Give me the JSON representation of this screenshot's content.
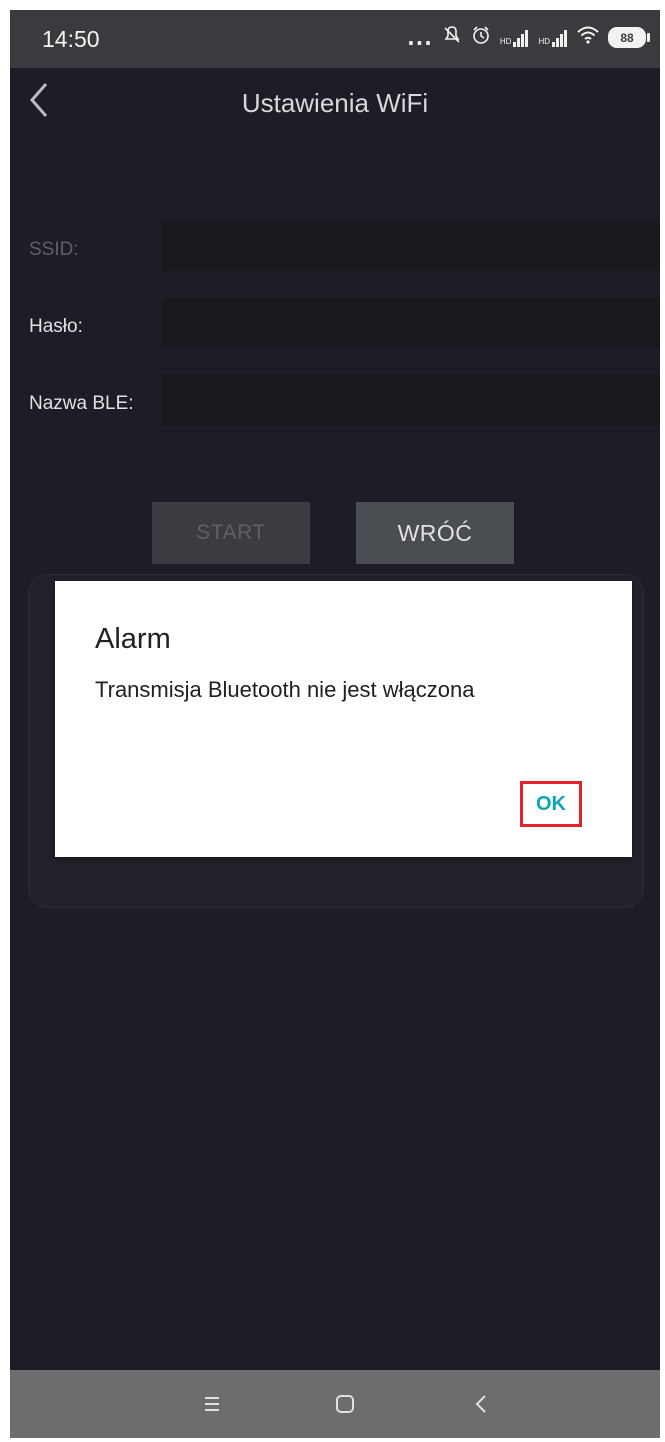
{
  "status_bar": {
    "time": "14:50",
    "icons": [
      "more-dots-icon",
      "mute-icon",
      "alarm-icon",
      "hd-signal-icon",
      "hd-signal-icon",
      "wifi-icon",
      "battery-icon"
    ],
    "more": "...",
    "hd1": "HD",
    "hd2": "HD",
    "battery": "88"
  },
  "header": {
    "title": "Ustawienia WiFi",
    "back_icon": "chevron-left-icon"
  },
  "form": {
    "ssid_label": "SSID:",
    "ssid_value": "",
    "password_label": "Hasło:",
    "password_value": "",
    "ble_label": "Nazwa BLE:",
    "ble_value": ""
  },
  "buttons": {
    "start": "START",
    "back": "WRÓĆ"
  },
  "dialog": {
    "title": "Alarm",
    "message": "Transmisja Bluetooth nie jest włączona",
    "ok": "OK"
  },
  "nav": {
    "icons": [
      "menu-icon",
      "home-icon",
      "back-icon"
    ]
  },
  "colors": {
    "background": "#1e1c27",
    "status_bar": "#3b3b3f",
    "nav_bar": "#6d6d70",
    "accent": "#0ea5b3",
    "highlight": "#e3232b"
  }
}
